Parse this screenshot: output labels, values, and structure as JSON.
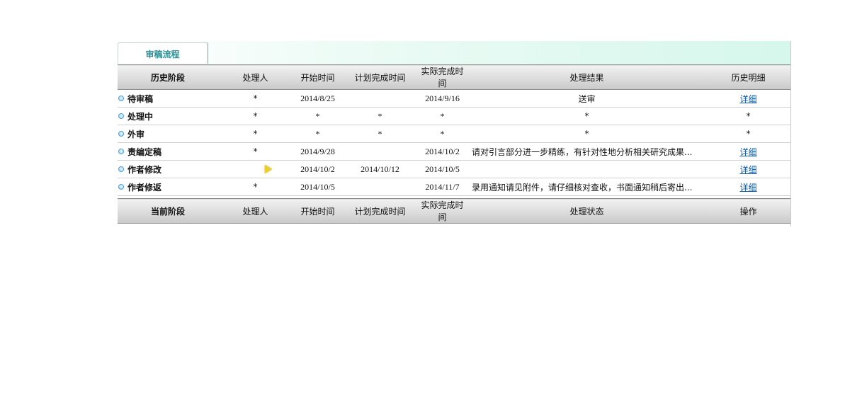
{
  "tab": {
    "label": "审稿流程"
  },
  "history": {
    "headers": [
      "历史阶段",
      "处理人",
      "开始时间",
      "计划完成时间",
      "实际完成时间",
      "处理结果",
      "历史明细"
    ],
    "rows": [
      {
        "stage": "待审稿",
        "handler": "*",
        "start": "2014/8/25",
        "planned": "",
        "actual": "2014/9/16",
        "result": "送审",
        "detail": "详细"
      },
      {
        "stage": "处理中",
        "handler": "*",
        "start": "*",
        "planned": "*",
        "actual": "*",
        "result": "*",
        "detail": "*"
      },
      {
        "stage": "外审",
        "handler": "*",
        "start": "*",
        "planned": "*",
        "actual": "*",
        "result": "*",
        "detail": "*"
      },
      {
        "stage": "责编定稿",
        "handler": "*",
        "start": "2014/9/28",
        "planned": "",
        "actual": "2014/10/2",
        "result": "请对引言部分进一步精练，有针对性地分析相关研究成果...",
        "detail": "详细"
      },
      {
        "stage": "作者修改",
        "handler": "",
        "start": "2014/10/2",
        "planned": "2014/10/12",
        "actual": "2014/10/5",
        "result": "",
        "detail": "详细"
      },
      {
        "stage": "作者修返",
        "handler": "*",
        "start": "2014/10/5",
        "planned": "",
        "actual": "2014/11/7",
        "result": "录用通知请见附件，请仔细核对查收，书面通知稍后寄出...",
        "detail": "详细"
      }
    ]
  },
  "current": {
    "headers": [
      "当前阶段",
      "处理人",
      "开始时间",
      "计划完成时间",
      "实际完成时间",
      "处理状态",
      "操作"
    ]
  },
  "colors": {
    "link": "#0b5aa6",
    "result_text": "#1f7f95",
    "tab_text": "#2f8f96",
    "tabbar_tint": "#d6f7ec",
    "arrow_icon": "#e9cf2a"
  }
}
